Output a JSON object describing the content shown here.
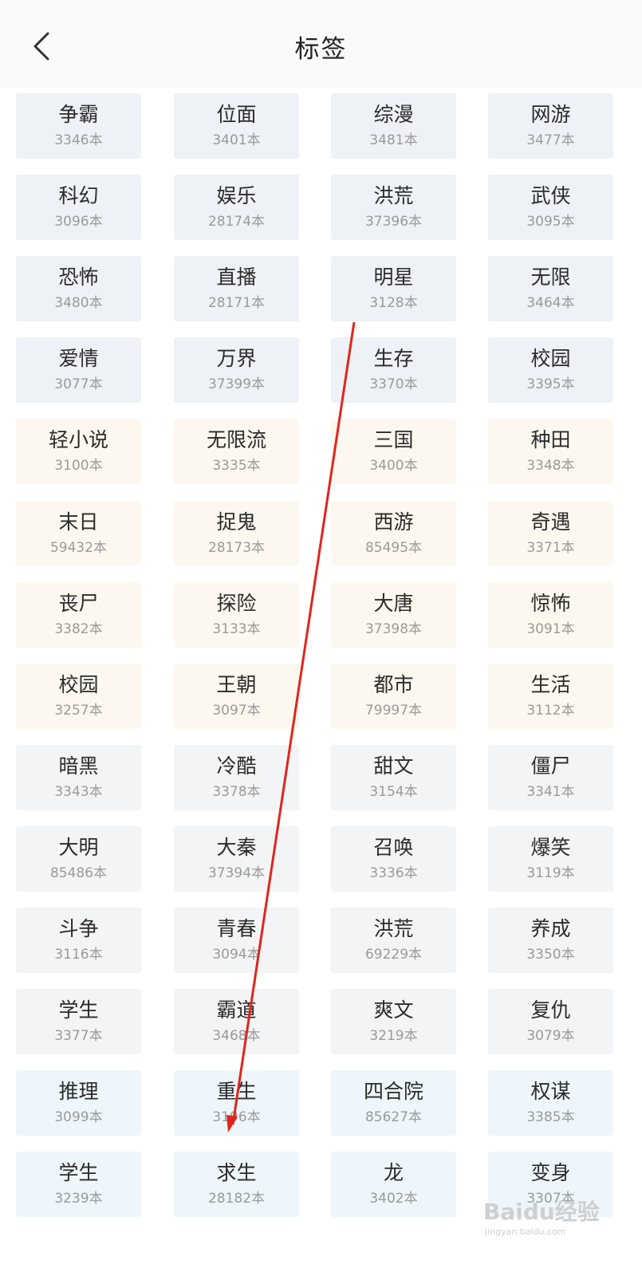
{
  "header": {
    "title": "标签"
  },
  "tags": [
    {
      "name": "争霸",
      "count": "3346本",
      "group": "blue"
    },
    {
      "name": "位面",
      "count": "3401本",
      "group": "blue"
    },
    {
      "name": "综漫",
      "count": "3481本",
      "group": "blue"
    },
    {
      "name": "网游",
      "count": "3477本",
      "group": "blue"
    },
    {
      "name": "科幻",
      "count": "3096本",
      "group": "blue"
    },
    {
      "name": "娱乐",
      "count": "28174本",
      "group": "blue"
    },
    {
      "name": "洪荒",
      "count": "37396本",
      "group": "blue"
    },
    {
      "name": "武侠",
      "count": "3095本",
      "group": "blue"
    },
    {
      "name": "恐怖",
      "count": "3480本",
      "group": "blue"
    },
    {
      "name": "直播",
      "count": "28171本",
      "group": "blue"
    },
    {
      "name": "明星",
      "count": "3128本",
      "group": "blue"
    },
    {
      "name": "无限",
      "count": "3464本",
      "group": "blue"
    },
    {
      "name": "爱情",
      "count": "3077本",
      "group": "blue"
    },
    {
      "name": "万界",
      "count": "37399本",
      "group": "blue"
    },
    {
      "name": "生存",
      "count": "3370本",
      "group": "blue"
    },
    {
      "name": "校园",
      "count": "3395本",
      "group": "blue"
    },
    {
      "name": "轻小说",
      "count": "3100本",
      "group": "cream"
    },
    {
      "name": "无限流",
      "count": "3335本",
      "group": "cream"
    },
    {
      "name": "三国",
      "count": "3400本",
      "group": "cream"
    },
    {
      "name": "种田",
      "count": "3348本",
      "group": "cream"
    },
    {
      "name": "末日",
      "count": "59432本",
      "group": "cream"
    },
    {
      "name": "捉鬼",
      "count": "28173本",
      "group": "cream"
    },
    {
      "name": "西游",
      "count": "85495本",
      "group": "cream"
    },
    {
      "name": "奇遇",
      "count": "3371本",
      "group": "cream"
    },
    {
      "name": "丧尸",
      "count": "3382本",
      "group": "cream"
    },
    {
      "name": "探险",
      "count": "3133本",
      "group": "cream"
    },
    {
      "name": "大唐",
      "count": "37398本",
      "group": "cream"
    },
    {
      "name": "惊怖",
      "count": "3091本",
      "group": "cream"
    },
    {
      "name": "校园",
      "count": "3257本",
      "group": "cream"
    },
    {
      "name": "王朝",
      "count": "3097本",
      "group": "cream"
    },
    {
      "name": "都市",
      "count": "79997本",
      "group": "cream"
    },
    {
      "name": "生活",
      "count": "3112本",
      "group": "cream"
    },
    {
      "name": "暗黑",
      "count": "3343本",
      "group": "gray"
    },
    {
      "name": "冷酷",
      "count": "3378本",
      "group": "gray"
    },
    {
      "name": "甜文",
      "count": "3154本",
      "group": "gray"
    },
    {
      "name": "僵尸",
      "count": "3341本",
      "group": "gray"
    },
    {
      "name": "大明",
      "count": "85486本",
      "group": "gray"
    },
    {
      "name": "大秦",
      "count": "37394本",
      "group": "gray"
    },
    {
      "name": "召唤",
      "count": "3336本",
      "group": "gray"
    },
    {
      "name": "爆笑",
      "count": "3119本",
      "group": "gray"
    },
    {
      "name": "斗争",
      "count": "3116本",
      "group": "gray"
    },
    {
      "name": "青春",
      "count": "3094本",
      "group": "gray"
    },
    {
      "name": "洪荒",
      "count": "69229本",
      "group": "gray"
    },
    {
      "name": "养成",
      "count": "3350本",
      "group": "gray"
    },
    {
      "name": "学生",
      "count": "3377本",
      "group": "gray"
    },
    {
      "name": "霸道",
      "count": "3468本",
      "group": "gray"
    },
    {
      "name": "爽文",
      "count": "3219本",
      "group": "gray"
    },
    {
      "name": "复仇",
      "count": "3079本",
      "group": "gray"
    },
    {
      "name": "推理",
      "count": "3099本",
      "group": "sky"
    },
    {
      "name": "重生",
      "count": "3196本",
      "group": "sky"
    },
    {
      "name": "四合院",
      "count": "85627本",
      "group": "sky"
    },
    {
      "name": "权谋",
      "count": "3385本",
      "group": "sky"
    },
    {
      "name": "学生",
      "count": "3239本",
      "group": "sky"
    },
    {
      "name": "求生",
      "count": "28182本",
      "group": "sky"
    },
    {
      "name": "龙",
      "count": "3402本",
      "group": "sky"
    },
    {
      "name": "变身",
      "count": "3307本",
      "group": "sky"
    }
  ],
  "colors": {
    "blue": "#eef1f5",
    "cream": "#fdf8ef",
    "gray": "#f3f4f6",
    "sky": "#eef6fb",
    "arrow": "#e0251c"
  },
  "icons": {
    "back": "chevron-left-icon"
  },
  "watermark": {
    "logo": "Baidu经验",
    "url": "jingyan.baidu.com"
  }
}
